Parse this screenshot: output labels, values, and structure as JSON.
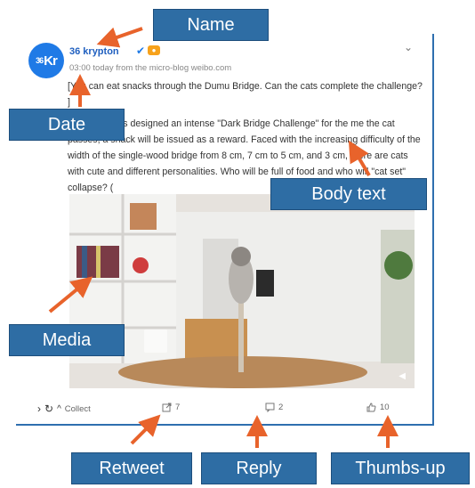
{
  "post": {
    "username": "36 krypton",
    "avatar_text_small": "36",
    "avatar_text": "Kr",
    "vip_badge": "●",
    "meta": "03:00 today from the micro-blog weibo.com",
    "paragraph1": "[You can eat snacks through the Dumu Bridge. Can the cats complete the challenge? ]",
    "paragraph2": "vel officer, has designed an intense \"Dark Bridge Challenge\" for the me the cat passes, a snack will be issued as a reward. Faced with the increasing difficulty of the width of the single-wood bridge from 8 cm, 7 cm to 5 cm, and 3 cm, there are cats with cute and different personalities. Who will be full of food and who will \"cat set\" collapse? (",
    "collect_label": "Collect",
    "retweet_count": "7",
    "reply_count": "2",
    "like_count": "10"
  },
  "annotations": {
    "name": "Name",
    "date": "Date",
    "body_text": "Body text",
    "media": "Media",
    "retweet": "Retweet",
    "reply": "Reply",
    "thumbs_up": "Thumbs-up"
  },
  "colors": {
    "accent": "#2e6da4",
    "arrow": "#e8632b",
    "link": "#1f5fbf"
  },
  "icons": [
    "chevron-down-icon",
    "verified-icon",
    "retweet-icon",
    "reply-icon",
    "thumbs-up-icon",
    "refresh-icon",
    "collapse-icon",
    "video-play-icon"
  ]
}
